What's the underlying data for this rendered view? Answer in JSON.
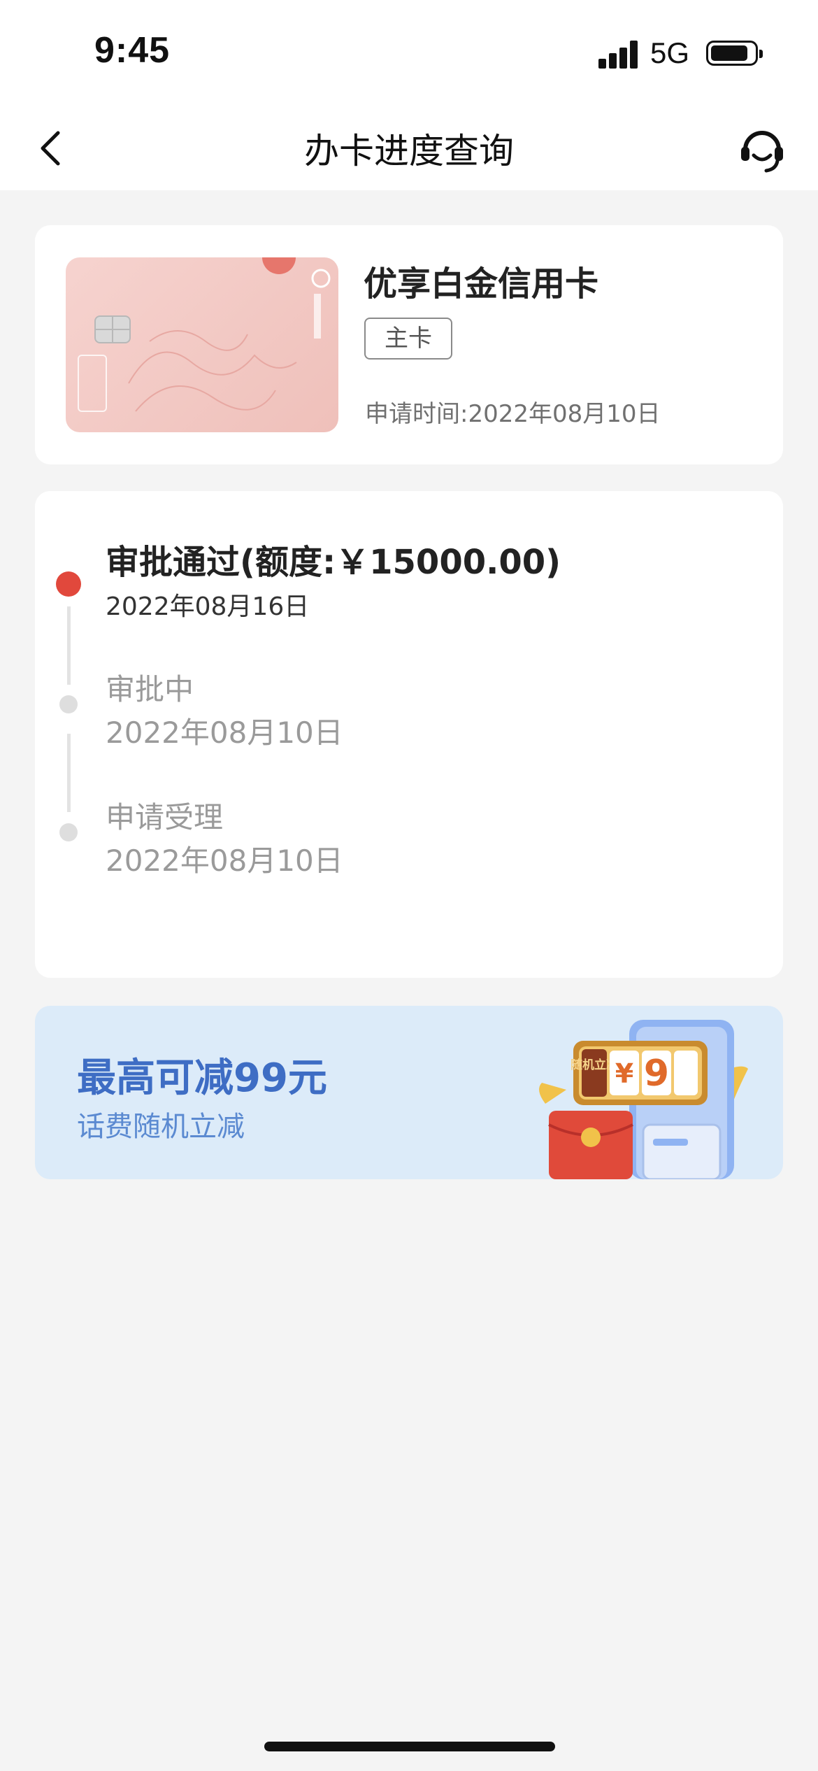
{
  "status_bar": {
    "time": "9:45",
    "network": "5G"
  },
  "nav": {
    "title": "办卡进度查询"
  },
  "card": {
    "name": "优享白金信用卡",
    "badge": "主卡",
    "apply_date": "申请时间:2022年08月10日"
  },
  "progress": {
    "steps": [
      {
        "title": "审批通过(额度:￥15000.00)",
        "date": "2022年08月16日",
        "status": "active"
      },
      {
        "title": "审批中",
        "date": "2022年08月10日",
        "status": "done"
      },
      {
        "title": "申请受理",
        "date": "2022年08月10日",
        "status": "done"
      }
    ]
  },
  "promo": {
    "title": "最高可减99元",
    "subtitle": "话费随机立减",
    "slot_label": "随机立减",
    "slot_symbol": "¥",
    "slot_digit": "9"
  },
  "colors": {
    "accent_red": "#e1483c",
    "promo_blue": "#3e6dc4",
    "card_pink": "#f1c6c0"
  }
}
